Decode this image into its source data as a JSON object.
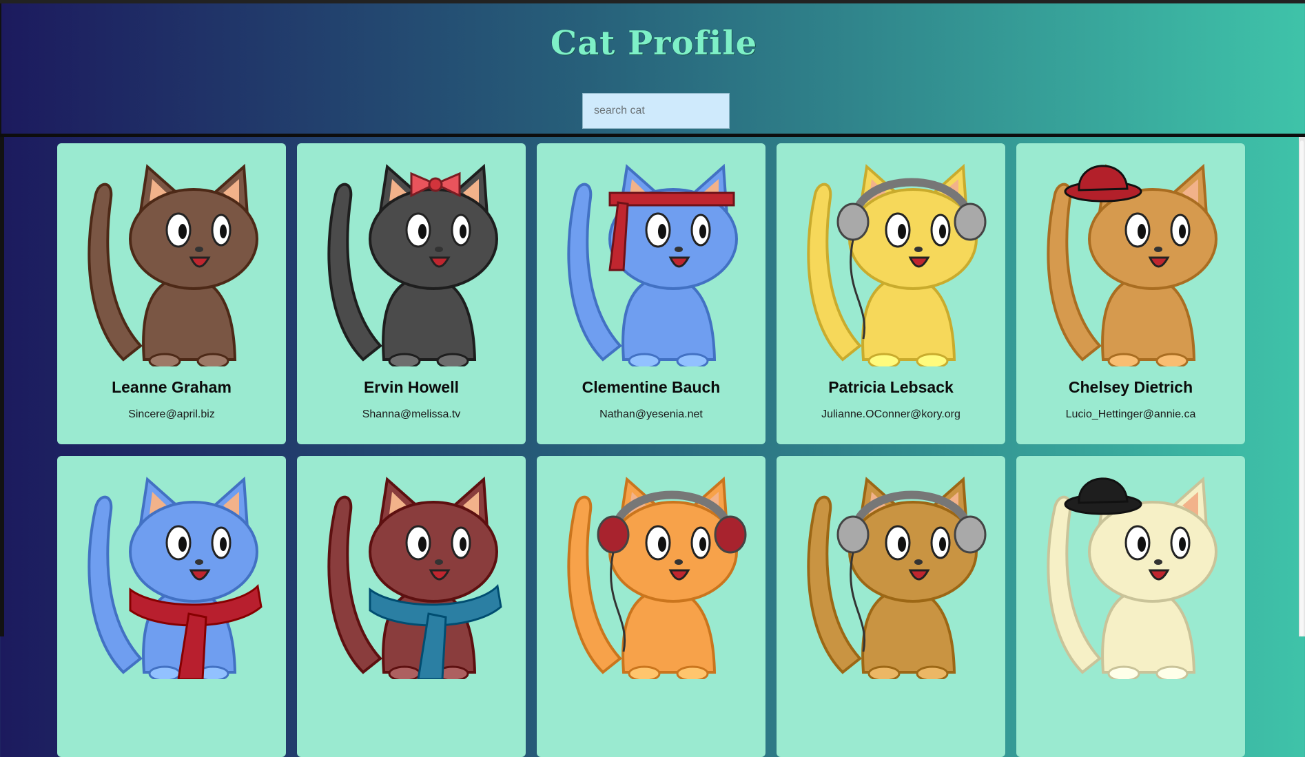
{
  "header": {
    "title": "Cat Profile",
    "search_placeholder": "search cat"
  },
  "colors": {
    "card_bg": "#9aead0",
    "title": "#7ef0c7",
    "search_bg": "#cfeafc"
  },
  "cats": [
    {
      "name": "Leanne Graham",
      "email": "Sincere@april.biz",
      "icon": "brown-cat-icon",
      "color": "#7a5644",
      "accessory": "none"
    },
    {
      "name": "Ervin Howell",
      "email": "Shanna@melissa.tv",
      "icon": "gray-cat-with-bow-icon",
      "color": "#4b4b4b",
      "accessory": "bow"
    },
    {
      "name": "Clementine Bauch",
      "email": "Nathan@yesenia.net",
      "icon": "blue-cat-with-headband-icon",
      "color": "#6f9ef0",
      "accessory": "headband"
    },
    {
      "name": "Patricia Lebsack",
      "email": "Julianne.OConner@kory.org",
      "icon": "yellow-cat-with-headphones-icon",
      "color": "#f6d85a",
      "accessory": "headphones"
    },
    {
      "name": "Chelsey Dietrich",
      "email": "Lucio_Hettinger@annie.ca",
      "icon": "orange-cat-with-red-hat-icon",
      "color": "#d69a4e",
      "accessory": "hat-red"
    },
    {
      "name": "",
      "email": "",
      "icon": "blue-cat-with-scarf-icon",
      "color": "#6f9ef0",
      "accessory": "scarf-red"
    },
    {
      "name": "",
      "email": "",
      "icon": "maroon-cat-with-scarf-icon",
      "color": "#8a3d3d",
      "accessory": "scarf-blue"
    },
    {
      "name": "",
      "email": "",
      "icon": "orange-cat-with-headphones-icon",
      "color": "#f7a24a",
      "accessory": "headphones-red"
    },
    {
      "name": "",
      "email": "",
      "icon": "golden-cat-with-headphones-icon",
      "color": "#c99442",
      "accessory": "headphones"
    },
    {
      "name": "",
      "email": "",
      "icon": "cream-cat-with-top-hat-icon",
      "color": "#f6f0c6",
      "accessory": "hat-black"
    }
  ]
}
